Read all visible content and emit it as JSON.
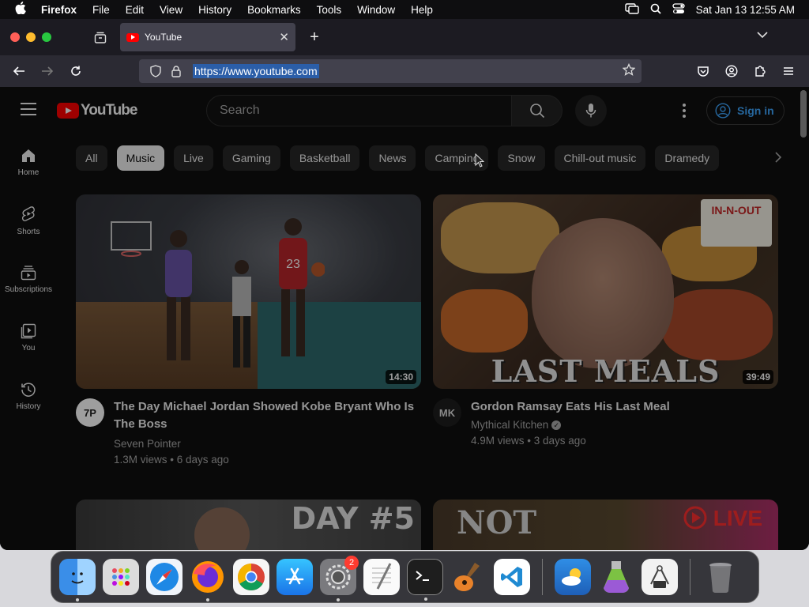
{
  "menubar": {
    "app": "Firefox",
    "items": [
      "File",
      "Edit",
      "View",
      "History",
      "Bookmarks",
      "Tools",
      "Window",
      "Help"
    ],
    "datetime": "Sat Jan 13  12:55 AM"
  },
  "browser": {
    "tab_title": "YouTube",
    "url": "https://www.youtube.com"
  },
  "youtube": {
    "logo_text": "YouTube",
    "search_placeholder": "Search",
    "sign_in": "Sign in",
    "sidebar": [
      {
        "label": "Home"
      },
      {
        "label": "Shorts"
      },
      {
        "label": "Subscriptions"
      },
      {
        "label": "You"
      },
      {
        "label": "History"
      }
    ],
    "chips": [
      "All",
      "Music",
      "Live",
      "Gaming",
      "Basketball",
      "News",
      "Camping",
      "Snow",
      "Chill-out music",
      "Dramedy"
    ],
    "active_chip": "Music",
    "videos": [
      {
        "title": "The Day Michael Jordan Showed Kobe Bryant Who Is The Boss",
        "channel": "Seven Pointer",
        "views": "1.3M views",
        "age": "6 days ago",
        "duration": "14:30",
        "avatar_text": "7P"
      },
      {
        "title": "Gordon Ramsay Eats His Last Meal",
        "channel": "Mythical Kitchen",
        "views": "4.9M views",
        "age": "3 days ago",
        "duration": "39:49",
        "avatar_text": "MK",
        "thumb_text": "LAST MEALS",
        "thumb_logo": "IN-N-OUT"
      }
    ],
    "next_row": {
      "left_thumb_text": "DAY #5",
      "right_thumb_text": "NOT",
      "right_live_text": "LIVE"
    }
  },
  "dock": {
    "apps": [
      "finder",
      "launchpad",
      "safari",
      "firefox",
      "chrome",
      "app-store",
      "system-settings",
      "textedit",
      "terminal",
      "garageband",
      "vscode",
      "weather",
      "automator",
      "instruments",
      "trash"
    ],
    "system_settings_badge": "2"
  }
}
